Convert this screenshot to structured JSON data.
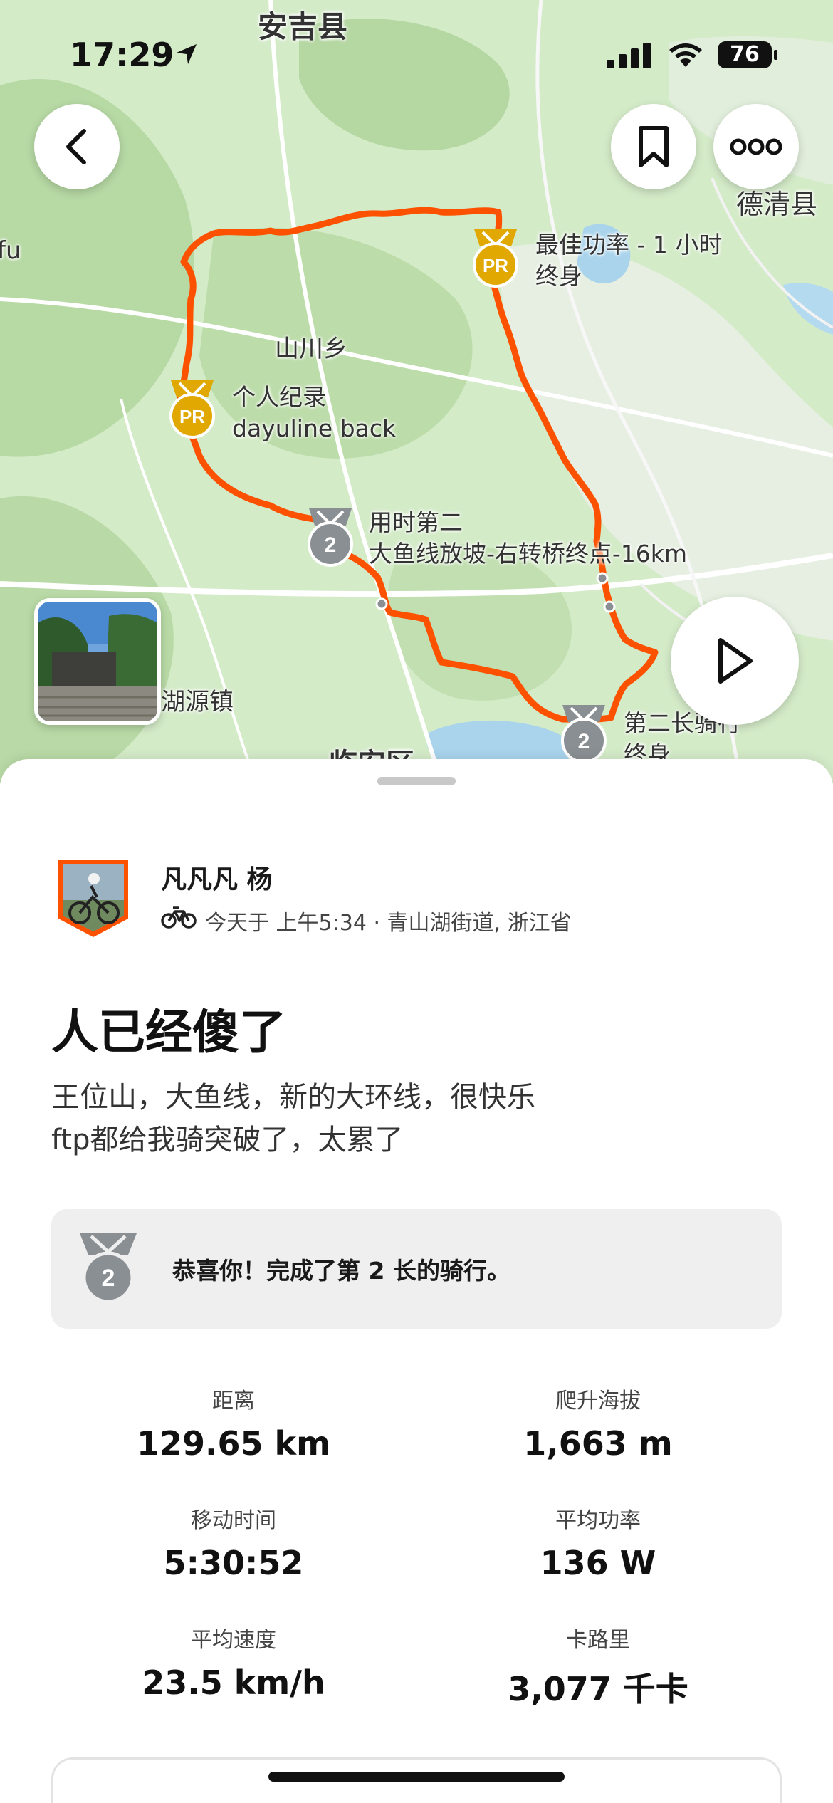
{
  "status_bar": {
    "time": "17:29",
    "battery": "76"
  },
  "map": {
    "places": [
      "安吉县",
      "德清县",
      "fu",
      "山川乡",
      "湖源镇",
      "临安区"
    ],
    "segments": [
      {
        "badge": "PR",
        "line1": "最佳功率 - 1 小时",
        "line2": "终身"
      },
      {
        "badge": "PR",
        "line1": "个人纪录",
        "line2": "dayuline back"
      },
      {
        "badge": "2",
        "line1": "用时第二",
        "line2": "大鱼线放坡-右转桥终点-16km"
      },
      {
        "badge": "2",
        "line1": "第二长骑行",
        "line2": "终身"
      }
    ],
    "colors": {
      "route": "#fc5200",
      "pr_gold": "#e0a800",
      "silver": "#8a8f94"
    }
  },
  "buttons": {
    "back": "chevron-left-icon",
    "bookmark": "bookmark-icon",
    "more": "more-icon",
    "play": "play-icon"
  },
  "activity": {
    "athlete": "凡凡凡 杨",
    "meta": "今天于 上午5:34 · 青山湖街道, 浙江省",
    "title": "人已经傻了",
    "description": [
      "王位山，大鱼线，新的大环线，很快乐",
      "ftp都给我骑突破了，太累了"
    ],
    "achievement": "恭喜你！完成了第 2 长的骑行。"
  },
  "stats": [
    {
      "label": "距离",
      "value": "129.65 km"
    },
    {
      "label": "爬升海拔",
      "value": "1,663 m"
    },
    {
      "label": "移动时间",
      "value": "5:30:52"
    },
    {
      "label": "平均功率",
      "value": "136 W"
    },
    {
      "label": "平均速度",
      "value": "23.5 km/h"
    },
    {
      "label": "卡路里",
      "value": "3,077 千卡"
    }
  ]
}
